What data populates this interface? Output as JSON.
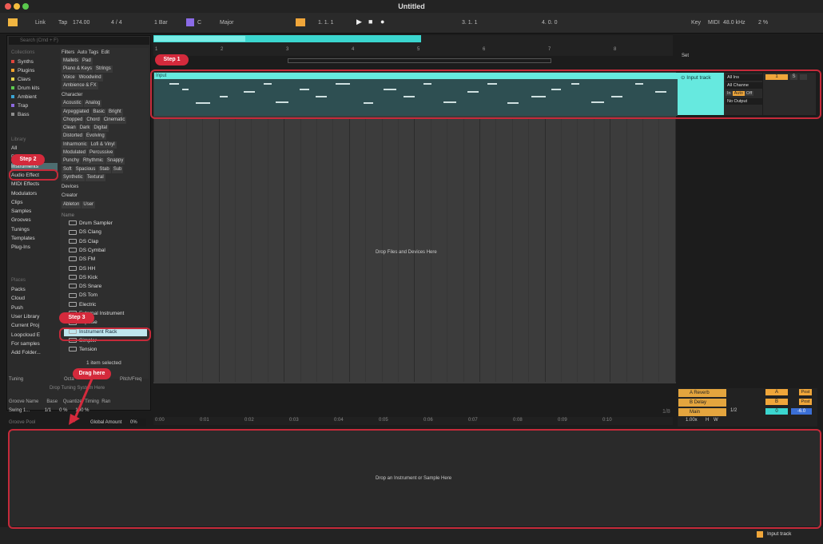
{
  "title": "Untitled",
  "control_bar": {
    "link": "Link",
    "tap": "Tap",
    "tempo": "174.00",
    "meter": "4 / 4",
    "quant": "1 Bar",
    "key_root": "C",
    "scale": "Major",
    "position": "1.  1.  1",
    "loop_start": "3.  1.  1",
    "loop_len": "4.  0.  0",
    "key_btn": "Key",
    "midi_btn": "MIDI",
    "sample_rate": "48.0 kHz",
    "cpu": "2 %"
  },
  "browser": {
    "search_placeholder": "Search (Cmd + F)",
    "collections_hdr": "Collections",
    "collections": [
      {
        "label": "Synths",
        "color": "#e0453c"
      },
      {
        "label": "Plugins",
        "color": "#f0a02c"
      },
      {
        "label": "Clavs",
        "color": "#e6d34a"
      },
      {
        "label": "Drum kits",
        "color": "#5cc94f"
      },
      {
        "label": "Ambient",
        "color": "#3aa5d6"
      },
      {
        "label": "Trap",
        "color": "#8d6ae0"
      },
      {
        "label": "Bass",
        "color": "#8f8f8f"
      }
    ],
    "library_hdr": "Library",
    "library": [
      "All",
      "Drums",
      "Instruments",
      "Audio Effect",
      "MIDI Effects",
      "Modulators",
      "Clips",
      "Samples",
      "Grooves",
      "Tunings",
      "Templates",
      "Plug-Ins"
    ],
    "places_hdr": "Places",
    "places": [
      "Packs",
      "Cloud",
      "Push",
      "User Library",
      "Current Proj",
      "Loopcloud E",
      "For samples",
      "Add Folder..."
    ],
    "filters_label": "Filters",
    "autotags_label": "Auto Tags",
    "edit_label": "Edit",
    "tag_rows": [
      [
        "Mallets",
        "Pad"
      ],
      [
        "Piano & Keys",
        "Strings"
      ],
      [
        "Voice",
        "Woodwind"
      ],
      [
        "Ambience & FX"
      ]
    ],
    "character_hdr": "Character",
    "character_rows": [
      [
        "Acoustic",
        "Analog"
      ],
      [
        "Arpeggiated",
        "Basic",
        "Bright"
      ],
      [
        "Chopped",
        "Chord",
        "Cinematic"
      ],
      [
        "Clean",
        "Dark",
        "Digital"
      ],
      [
        "Distorted",
        "Evolving"
      ],
      [
        "Inharmonic",
        "Lofi & Vinyl"
      ],
      [
        "Modulated",
        "Percussive"
      ],
      [
        "Punchy",
        "Rhythmic",
        "Snappy"
      ],
      [
        "Soft",
        "Spacious",
        "Stab",
        "Sub"
      ],
      [
        "Synthetic",
        "Textural"
      ]
    ],
    "devices_hdr": "Devices",
    "creator_hdr": "Creator",
    "creator_row": [
      "Ableton",
      "User"
    ],
    "name_hdr": "Name",
    "items": [
      "Drum Sampler",
      "DS Clang",
      "DS Clap",
      "DS Cymbal",
      "DS FM",
      "DS HH",
      "DS Kick",
      "DS Snare",
      "DS Tom",
      "Electric",
      "External Instrument",
      "Impulse",
      "Instrument Rack",
      "Simpler",
      "Tension"
    ],
    "selected_count": "1 item selected"
  },
  "tuning": {
    "hdr": "Tuning",
    "octave": "Octa",
    "pitch": "Pitch/Freq",
    "drop": "Drop Tuning System Here"
  },
  "groove": {
    "name_hdr": "Groove Name",
    "base_hdr": "Base",
    "quant_hdr": "Quantize",
    "timing_hdr": "Timing",
    "ran_hdr": "Ran",
    "row_name": "Swing 1...",
    "row_base": "1/1",
    "row_quant": "0 %",
    "row_timing": "100 %",
    "pool": "Groove Pool",
    "global": "Global Amount",
    "global_val": "0%"
  },
  "arrangement": {
    "bars": [
      "1",
      "2",
      "3",
      "4",
      "5",
      "6",
      "7",
      "8"
    ],
    "clip_name": "Input",
    "drop_hint": "Drop Files and Devices Here",
    "set_label": "Set",
    "times": [
      "0:00",
      "0:01",
      "0:02",
      "0:03",
      "0:04",
      "0:05",
      "0:06",
      "0:07",
      "0:08",
      "0:09",
      "0:10"
    ],
    "grid": "1/8"
  },
  "track": {
    "name": "Input track",
    "input_type": "All Ins",
    "channel": "All Channe",
    "monitor_in": "In",
    "monitor_auto": "Auto",
    "monitor_off": "Off",
    "output": "No Output",
    "number": "1",
    "solo": "S"
  },
  "returns": [
    {
      "name": "A Reverb",
      "letter": "A"
    },
    {
      "name": "B Delay",
      "letter": "B"
    }
  ],
  "main": {
    "name": "Main",
    "routing": "1/2",
    "zero": "0",
    "gain": "-6.0",
    "post": "Post",
    "tempo_nudge": "1.00x",
    "h": "H",
    "w": "W"
  },
  "device_hint": "Drop an Instrument or Sample Here",
  "steps": {
    "s1": "Step 1",
    "s2": "Step 2",
    "s3": "Step 3",
    "drag": "Drag here"
  },
  "status": {
    "track": "Input track"
  }
}
